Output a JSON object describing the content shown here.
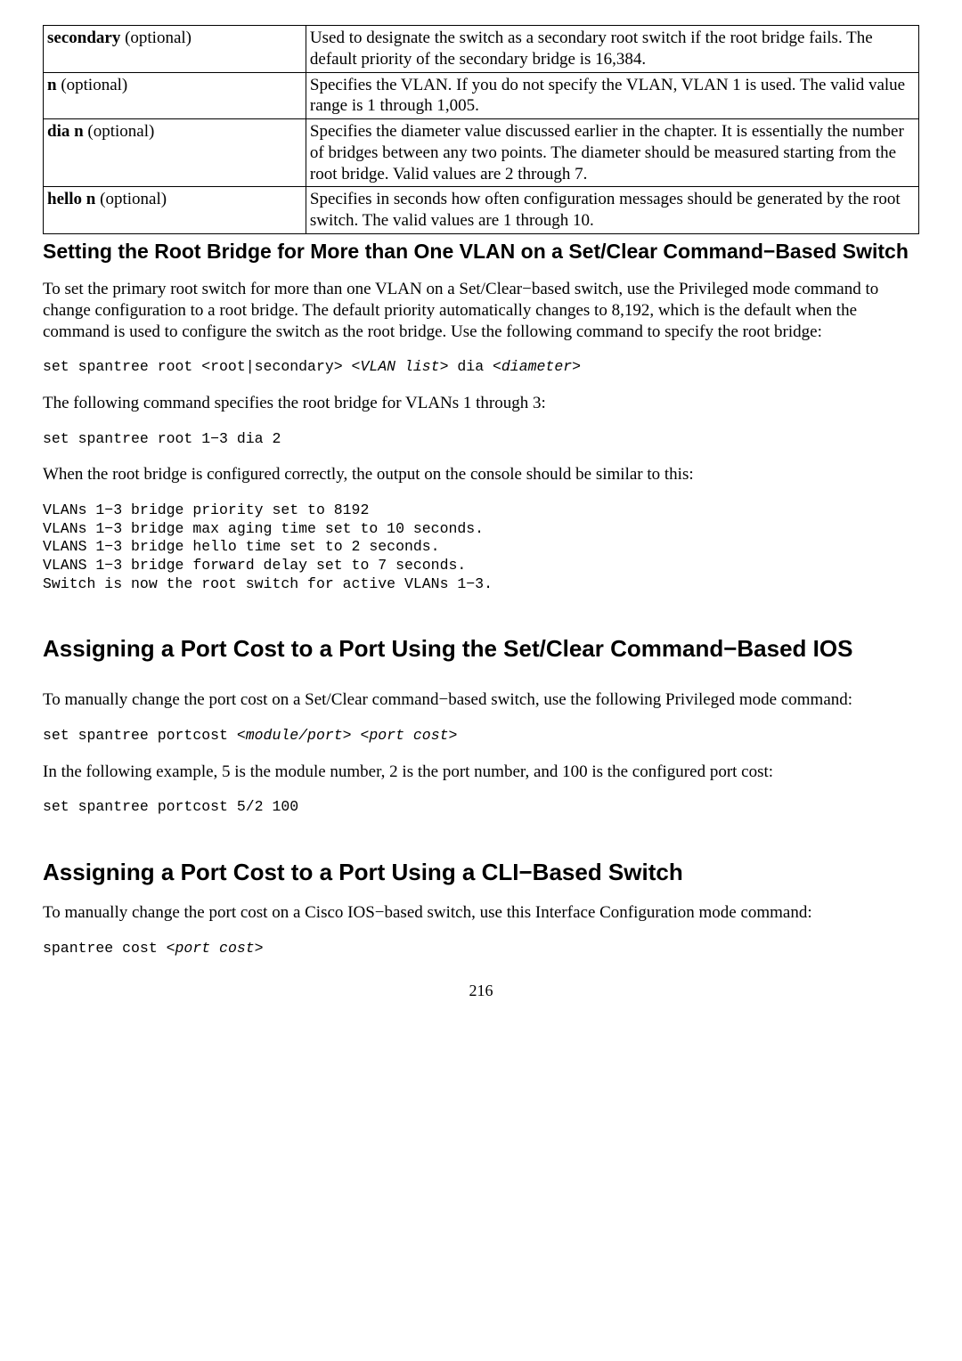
{
  "table": {
    "rows": [
      {
        "label_bold": "secondary",
        "label_rest": " (optional)",
        "desc": "Used to designate the switch as a secondary root switch if the root bridge fails. The default priority of the secondary bridge is 16,384."
      },
      {
        "label_bold": "n",
        "label_rest": " (optional)",
        "desc": "Specifies the VLAN. If you do not specify the VLAN, VLAN 1 is used. The valid value range is 1 through 1,005."
      },
      {
        "label_bold": "dia n",
        "label_rest": " (optional)",
        "desc": "Specifies the diameter value discussed earlier in the chapter. It is essentially the number of bridges between any two points. The diameter should be measured starting from the root bridge. Valid values are 2 through 7."
      },
      {
        "label_bold": "hello n",
        "label_rest": " (optional)",
        "desc": "Specifies in seconds how often configuration messages should be generated by the root switch. The valid values are 1 through 10."
      }
    ]
  },
  "section1": {
    "heading": "Setting the Root Bridge for More than One VLAN on a Set/Clear Command−Based Switch",
    "p1": "To set the primary root switch for more than one VLAN on a Set/Clear−based switch, use the Privileged mode command to change configuration to a root bridge. The default priority automatically changes to 8,192, which is the default when the command is used to configure the switch as the root bridge. Use the following command to specify the root bridge:",
    "code1_a": "set spantree root <root|secondary> <",
    "code1_b": "VLAN list",
    "code1_c": "> dia <",
    "code1_d": "diameter",
    "code1_e": ">",
    "p2": "The following command specifies the root bridge for VLANs 1 through 3:",
    "code2": "set spantree root 1−3 dia 2",
    "p3": "When the root bridge is configured correctly, the output on the console should be similar to this:",
    "code3": "VLANs 1−3 bridge priority set to 8192\nVLANs 1−3 bridge max aging time set to 10 seconds.\nVLANS 1−3 bridge hello time set to 2 seconds.\nVLANS 1−3 bridge forward delay set to 7 seconds.\nSwitch is now the root switch for active VLANs 1−3."
  },
  "section2": {
    "heading": "Assigning a Port Cost to a Port Using the Set/Clear Command−Based IOS",
    "p1": "To manually change the port cost on a Set/Clear command−based switch, use the following Privileged mode command:",
    "code1_a": "set spantree portcost <",
    "code1_b": "module/port",
    "code1_c": "> <",
    "code1_d": "port cost",
    "code1_e": ">",
    "p2": "In the following example, 5 is the module number, 2 is the port number, and 100 is the configured port cost:",
    "code2": "set spantree portcost 5/2 100"
  },
  "section3": {
    "heading": "Assigning a Port Cost to a Port Using a CLI−Based Switch",
    "p1": "To manually change the port cost on a Cisco IOS−based switch, use this Interface Configuration mode command:",
    "code1_a": "spantree cost <",
    "code1_b": "port cost",
    "code1_c": ">"
  },
  "pagenum": "216"
}
